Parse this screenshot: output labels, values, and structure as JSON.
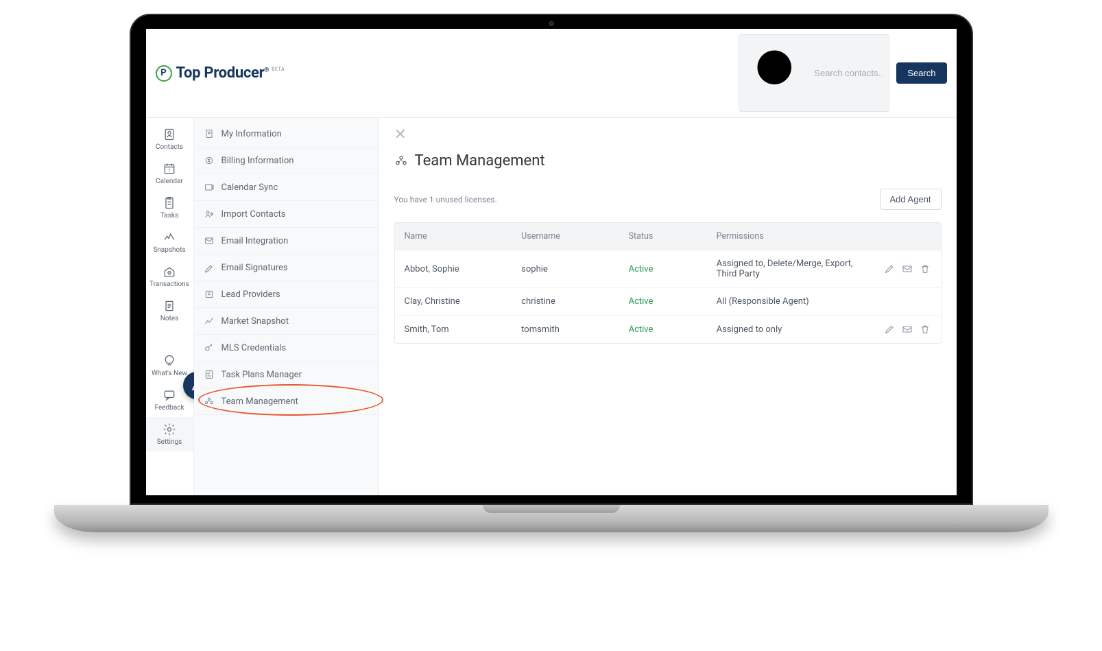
{
  "brand": {
    "name": "Top Producer",
    "beta": "BETA",
    "logo_letter": "P"
  },
  "header": {
    "search_placeholder": "Search contacts...",
    "search_button": "Search"
  },
  "sidebar": {
    "items": [
      {
        "id": "contacts",
        "label": "Contacts"
      },
      {
        "id": "calendar",
        "label": "Calendar"
      },
      {
        "id": "tasks",
        "label": "Tasks"
      },
      {
        "id": "snapshots",
        "label": "Snapshots"
      },
      {
        "id": "transactions",
        "label": "Transactions"
      },
      {
        "id": "notes",
        "label": "Notes"
      },
      {
        "id": "whatsnew",
        "label": "What's New"
      },
      {
        "id": "feedback",
        "label": "Feedback"
      },
      {
        "id": "settings",
        "label": "Settings"
      }
    ]
  },
  "settings_menu": {
    "items": [
      "My Information",
      "Billing Information",
      "Calendar Sync",
      "Import Contacts",
      "Email Integration",
      "Email Signatures",
      "Lead Providers",
      "Market Snapshot",
      "MLS Credentials",
      "Task Plans Manager",
      "Team Management"
    ]
  },
  "main": {
    "title": "Team Management",
    "license_text": "You have 1 unused licenses.",
    "add_agent_button": "Add Agent",
    "columns": {
      "name": "Name",
      "username": "Username",
      "status": "Status",
      "permissions": "Permissions"
    },
    "agents": [
      {
        "name": "Abbot, Sophie",
        "username": "sophie",
        "status": "Active",
        "permissions": "Assigned to, Delete/Merge, Export, Third Party",
        "has_actions": true
      },
      {
        "name": "Clay, Christine",
        "username": "christine",
        "status": "Active",
        "permissions": "All (Responsible Agent)",
        "has_actions": false
      },
      {
        "name": "Smith, Tom",
        "username": "tomsmith",
        "status": "Active",
        "permissions": "Assigned to only",
        "has_actions": true
      }
    ]
  }
}
